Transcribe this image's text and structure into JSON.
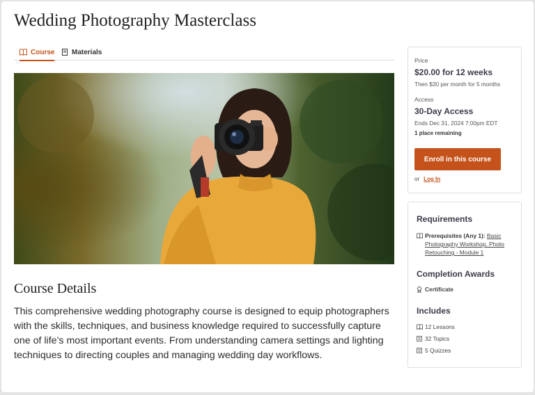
{
  "course": {
    "title": "Wedding Photography Masterclass"
  },
  "tabs": [
    {
      "label": "Course",
      "icon": "book-icon",
      "active": true
    },
    {
      "label": "Materials",
      "icon": "document-icon",
      "active": false
    }
  ],
  "details": {
    "heading": "Course Details",
    "body": "This comprehensive wedding photography course is designed to equip photographers with the skills, techniques, and business knowledge required to successfully capture one of life’s most important events. From understanding camera settings and lighting techniques to directing couples and managing wedding day workflows."
  },
  "pricing": {
    "price_label": "Price",
    "price_value": "$20.00 for 12 weeks",
    "price_note": "Then $30 per month for 5 months",
    "access_label": "Access",
    "access_value": "30-Day Access",
    "access_end": "Ends Dec 31, 2024 7:00pm EDT",
    "remaining": "1 place remaining",
    "enroll_label": "Enroll in this course",
    "or_text": "or",
    "login_label": "Log In"
  },
  "requirements": {
    "heading": "Requirements",
    "prereq_label": "Prerequisites (Any 1):",
    "prereq_links": "Basic Photography Workshop, Photo Retouching - Module 1"
  },
  "awards": {
    "heading": "Completion Awards",
    "item": "Certificate"
  },
  "includes": {
    "heading": "Includes",
    "items": [
      {
        "label": "12 Lessons",
        "icon": "book-icon"
      },
      {
        "label": "32 Topics",
        "icon": "list-icon"
      },
      {
        "label": "5 Quizzes",
        "icon": "list-icon"
      }
    ]
  },
  "colors": {
    "accent": "#c4521a",
    "heading": "#3a3a48"
  }
}
